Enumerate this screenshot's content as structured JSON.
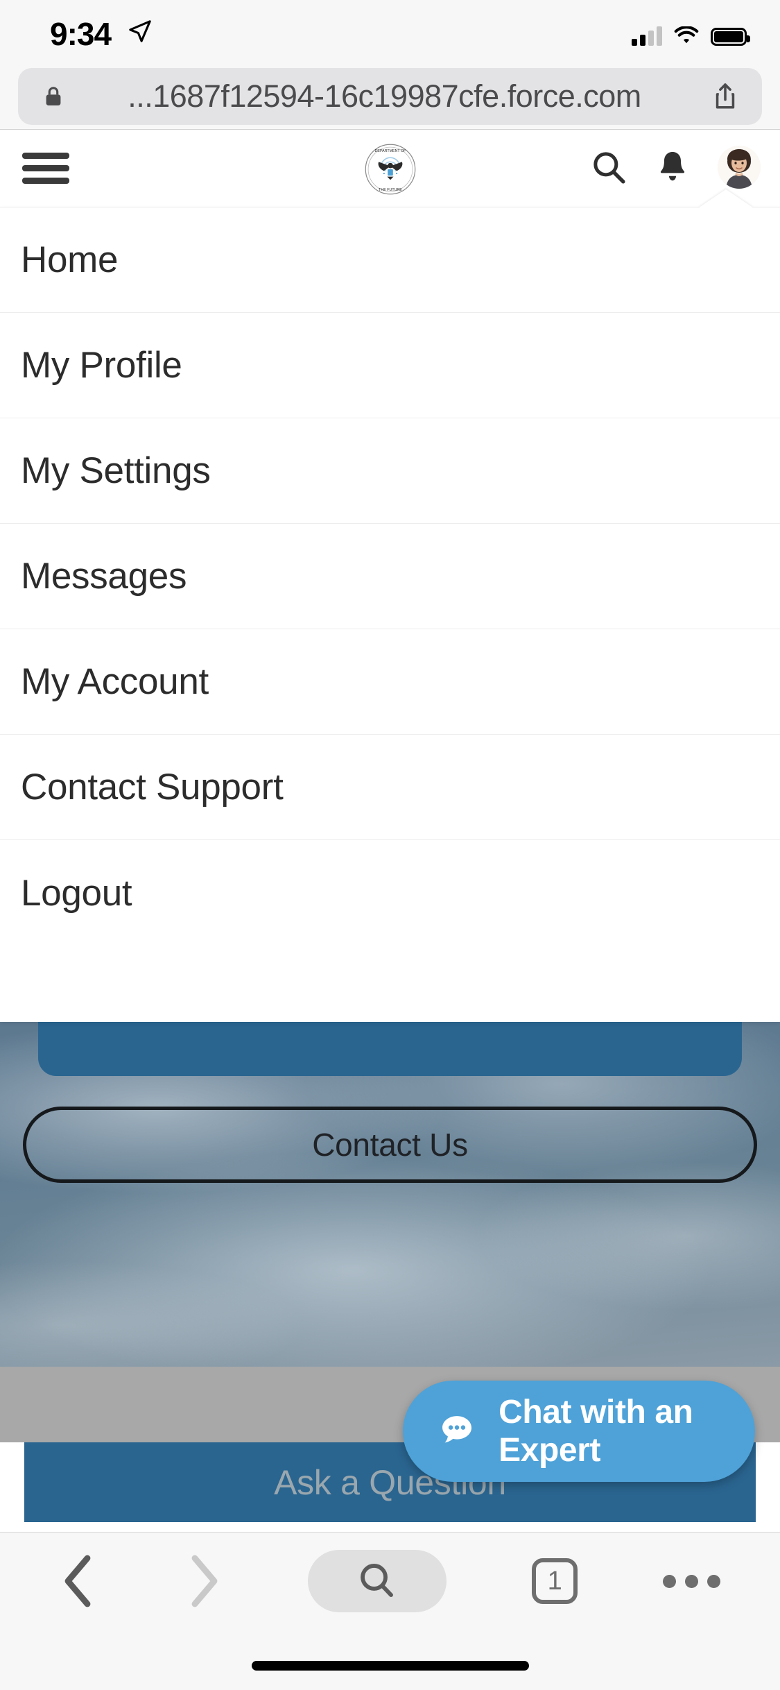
{
  "status_bar": {
    "time": "9:34",
    "location_icon": "location-arrow-icon",
    "cellular_icon": "signal-bars-icon",
    "cellular_bars_filled": 2,
    "cellular_bars_total": 4,
    "wifi_icon": "wifi-icon",
    "battery_icon": "battery-full-icon"
  },
  "browser": {
    "url": "...1687f12594-16c19987cfe.force.com",
    "lock_icon": "lock-icon",
    "share_icon": "share-icon",
    "toolbar": {
      "back_label": "Back",
      "back_icon": "chevron-left-icon",
      "forward_label": "Forward",
      "forward_icon": "chevron-right-icon",
      "search_label": "Search",
      "search_icon": "magnifier-icon",
      "tabs_count": "1",
      "more_label": "More",
      "more_icon": "ellipsis-icon"
    }
  },
  "site_header": {
    "menu_icon": "hamburger-menu-icon",
    "logo_alt": "Department of the Future seal",
    "logo_text_top": "DEPARTMENT OF",
    "logo_text_bottom": "THE FUTURE",
    "search_icon": "search-icon",
    "notifications_icon": "bell-icon",
    "avatar_alt": "User profile photo"
  },
  "dropdown": {
    "items": [
      {
        "label": "Home"
      },
      {
        "label": "My Profile"
      },
      {
        "label": "My Settings"
      },
      {
        "label": "Messages"
      },
      {
        "label": "My Account"
      },
      {
        "label": "Contact Support"
      },
      {
        "label": "Logout"
      }
    ]
  },
  "page": {
    "contact_button_label": "Contact Us",
    "ask_panel_label": "Ask a Question"
  },
  "chat_widget": {
    "label": "Chat with an Expert",
    "icon": "chat-bubble-icon"
  },
  "colors": {
    "brand_blue": "#2a6590",
    "chat_blue": "#4ea2d8",
    "gray_band": "#a8a8a8",
    "menu_text": "#2c2c2c",
    "safari_chrome": "#f7f7f7"
  }
}
